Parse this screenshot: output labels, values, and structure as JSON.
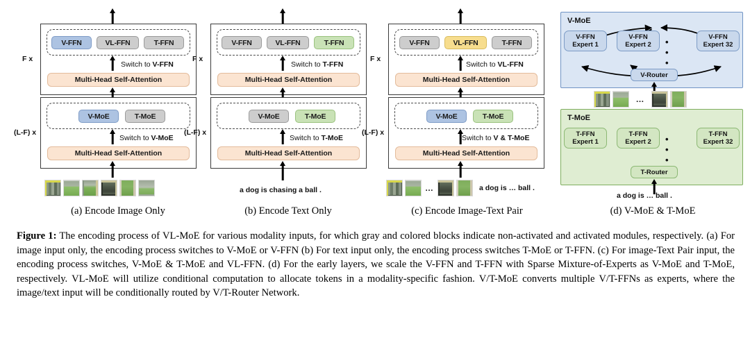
{
  "figure": {
    "label": "Figure 1:",
    "caption_text": "The encoding process of VL-MoE for various modality inputs, for which gray and colored blocks indicate non-activated and activated modules, respectively. (a) For image input only, the encoding process switches to V-MoE or V-FFN (b) For text input only, the encoding process switches T-MoE or T-FFN. (c) For image-Text Pair input, the encoding process switches, V-MoE & T-MoE and VL-FFN. (d) For the early layers, we scale the V-FFN and T-FFN with Sparse Mixture-of-Experts as V-MoE and T-MoE, respectively. VL-MoE will utilize conditional computation to allocate tokens in a modality-specific fashion. V/T-MoE converts multiple V/T-FFNs as experts, where the image/text input will be conditionally routed by V/T-Router Network."
  },
  "colors": {
    "gray_block": "#cdcdcd",
    "blue_block": "#adc3e2",
    "green_block": "#c9e2b6",
    "yellow_block": "#f7dd8e",
    "attention_block": "#fbe4d1",
    "vmoe_panel_bg": "#dbe6f4",
    "vmoe_panel_border": "#6f93c4",
    "tmoe_panel_bg": "#dfedd2",
    "tmoe_panel_border": "#7fae5f"
  },
  "common": {
    "attention_label": "Multi-Head Self-Attention",
    "top_reps_label": "F x",
    "bottom_reps_label": "(L-F) x",
    "switch_prefix": "Switch to ",
    "ellipsis": "…"
  },
  "panels": [
    {
      "id": "a",
      "subcaption": "(a) Encode Image Only",
      "top": {
        "reps": "F x",
        "switch_prefix": "Switch to ",
        "switch_target": "V-FFN",
        "blocks": [
          {
            "label": "V-FFN",
            "state": "active",
            "color": "blue"
          },
          {
            "label": "VL-FFN",
            "state": "inactive",
            "color": "gray"
          },
          {
            "label": "T-FFN",
            "state": "inactive",
            "color": "gray"
          }
        ],
        "attention": "Multi-Head Self-Attention"
      },
      "bottom": {
        "reps": "(L-F) x",
        "switch_prefix": "Switch to ",
        "switch_target": "V-MoE",
        "blocks": [
          {
            "label": "V-MoE",
            "state": "active",
            "color": "blue"
          },
          {
            "label": "T-MoE",
            "state": "inactive",
            "color": "gray"
          }
        ],
        "attention": "Multi-Head Self-Attention"
      },
      "input": {
        "type": "image-patches",
        "patch_count": 6,
        "text": ""
      }
    },
    {
      "id": "b",
      "subcaption": "(b) Encode Text Only",
      "top": {
        "reps": "F x",
        "switch_prefix": "Switch to ",
        "switch_target": "T-FFN",
        "blocks": [
          {
            "label": "V-FFN",
            "state": "inactive",
            "color": "gray"
          },
          {
            "label": "VL-FFN",
            "state": "inactive",
            "color": "gray"
          },
          {
            "label": "T-FFN",
            "state": "active",
            "color": "green"
          }
        ],
        "attention": "Multi-Head Self-Attention"
      },
      "bottom": {
        "reps": "(L-F) x",
        "switch_prefix": "Switch to ",
        "switch_target": "T-MoE",
        "blocks": [
          {
            "label": "V-MoE",
            "state": "inactive",
            "color": "gray"
          },
          {
            "label": "T-MoE",
            "state": "active",
            "color": "green"
          }
        ],
        "attention": "Multi-Head Self-Attention"
      },
      "input": {
        "type": "text",
        "patch_count": 0,
        "text": "a dog is chasing a ball ."
      }
    },
    {
      "id": "c",
      "subcaption": "(c) Encode Image-Text Pair",
      "top": {
        "reps": "F x",
        "switch_prefix": "Switch to ",
        "switch_target": "VL-FFN",
        "blocks": [
          {
            "label": "V-FFN",
            "state": "inactive",
            "color": "gray"
          },
          {
            "label": "VL-FFN",
            "state": "active",
            "color": "yellow"
          },
          {
            "label": "T-FFN",
            "state": "inactive",
            "color": "gray"
          }
        ],
        "attention": "Multi-Head Self-Attention"
      },
      "bottom": {
        "reps": "(L-F) x",
        "switch_prefix": "Switch to ",
        "switch_target": "V & T-MoE",
        "blocks": [
          {
            "label": "V-MoE",
            "state": "active",
            "color": "blue"
          },
          {
            "label": "T-MoE",
            "state": "active",
            "color": "green"
          }
        ],
        "attention": "Multi-Head Self-Attention"
      },
      "input": {
        "type": "image-patches-and-text",
        "patch_count": 4,
        "text": "a dog is … ball ."
      }
    }
  ],
  "moe_panel": {
    "subcaption": "(d) V-MoE & T-MoE",
    "vmoe": {
      "title": "V-MoE",
      "experts": [
        {
          "line1": "V-FFN",
          "line2": "Expert 1"
        },
        {
          "line1": "V-FFN",
          "line2": "Expert 2"
        },
        {
          "line1": "V-FFN",
          "line2": "Expert 32"
        }
      ],
      "ellipsis": "• • •",
      "router": "V-Router",
      "input": {
        "type": "image-patches",
        "patch_count": 4,
        "ellipsis": "…",
        "text": ""
      }
    },
    "tmoe": {
      "title": "T-MoE",
      "experts": [
        {
          "line1": "T-FFN",
          "line2": "Expert 1"
        },
        {
          "line1": "T-FFN",
          "line2": "Expert 2"
        },
        {
          "line1": "T-FFN",
          "line2": "Expert 32"
        }
      ],
      "ellipsis": "• • •",
      "router": "T-Router",
      "input": {
        "type": "text",
        "text": "a dog is … ball ."
      }
    }
  }
}
